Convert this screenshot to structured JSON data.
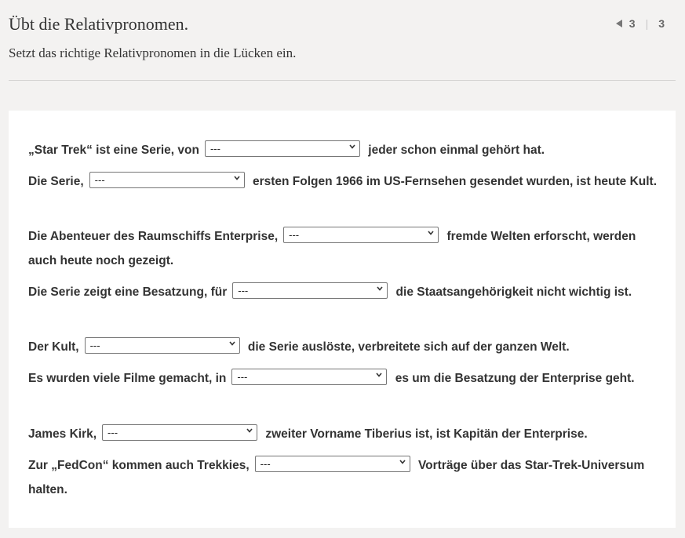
{
  "header": {
    "title": "Übt die Relativpronomen.",
    "subtitle": "Setzt das richtige Relativpronomen in die Lücken ein.",
    "pager": {
      "current": "3",
      "total": "3"
    }
  },
  "questions": [
    {
      "before": "„Star Trek“ ist eine Serie, von",
      "select": "---",
      "after": "jeder schon einmal gehört hat."
    },
    {
      "before": "Die Serie,",
      "select": "---",
      "after": "ersten Folgen 1966 im US-Fernsehen gesendet wurden, ist heute Kult."
    },
    {
      "before": "Die Abenteuer des Raumschiffs Enterprise,",
      "select": "---",
      "after": "fremde Welten erforscht, werden auch heute noch gezeigt."
    },
    {
      "before": "Die Serie zeigt eine Besatzung, für",
      "select": "---",
      "after": "die Staatsangehörigkeit nicht wichtig ist."
    },
    {
      "before": "Der Kult,",
      "select": "---",
      "after": "die Serie auslöste, verbreitete sich auf der ganzen Welt."
    },
    {
      "before": "Es wurden viele Filme gemacht, in",
      "select": "---",
      "after": "es um die Besatzung der Enterprise geht."
    },
    {
      "before": "James Kirk,",
      "select": "---",
      "after": "zweiter Vorname Tiberius ist, ist Kapitän der Enterprise."
    },
    {
      "before": "Zur „FedCon“ kommen auch Trekkies,",
      "select": "---",
      "after": "Vorträge über das Star-Trek-Universum halten."
    }
  ]
}
